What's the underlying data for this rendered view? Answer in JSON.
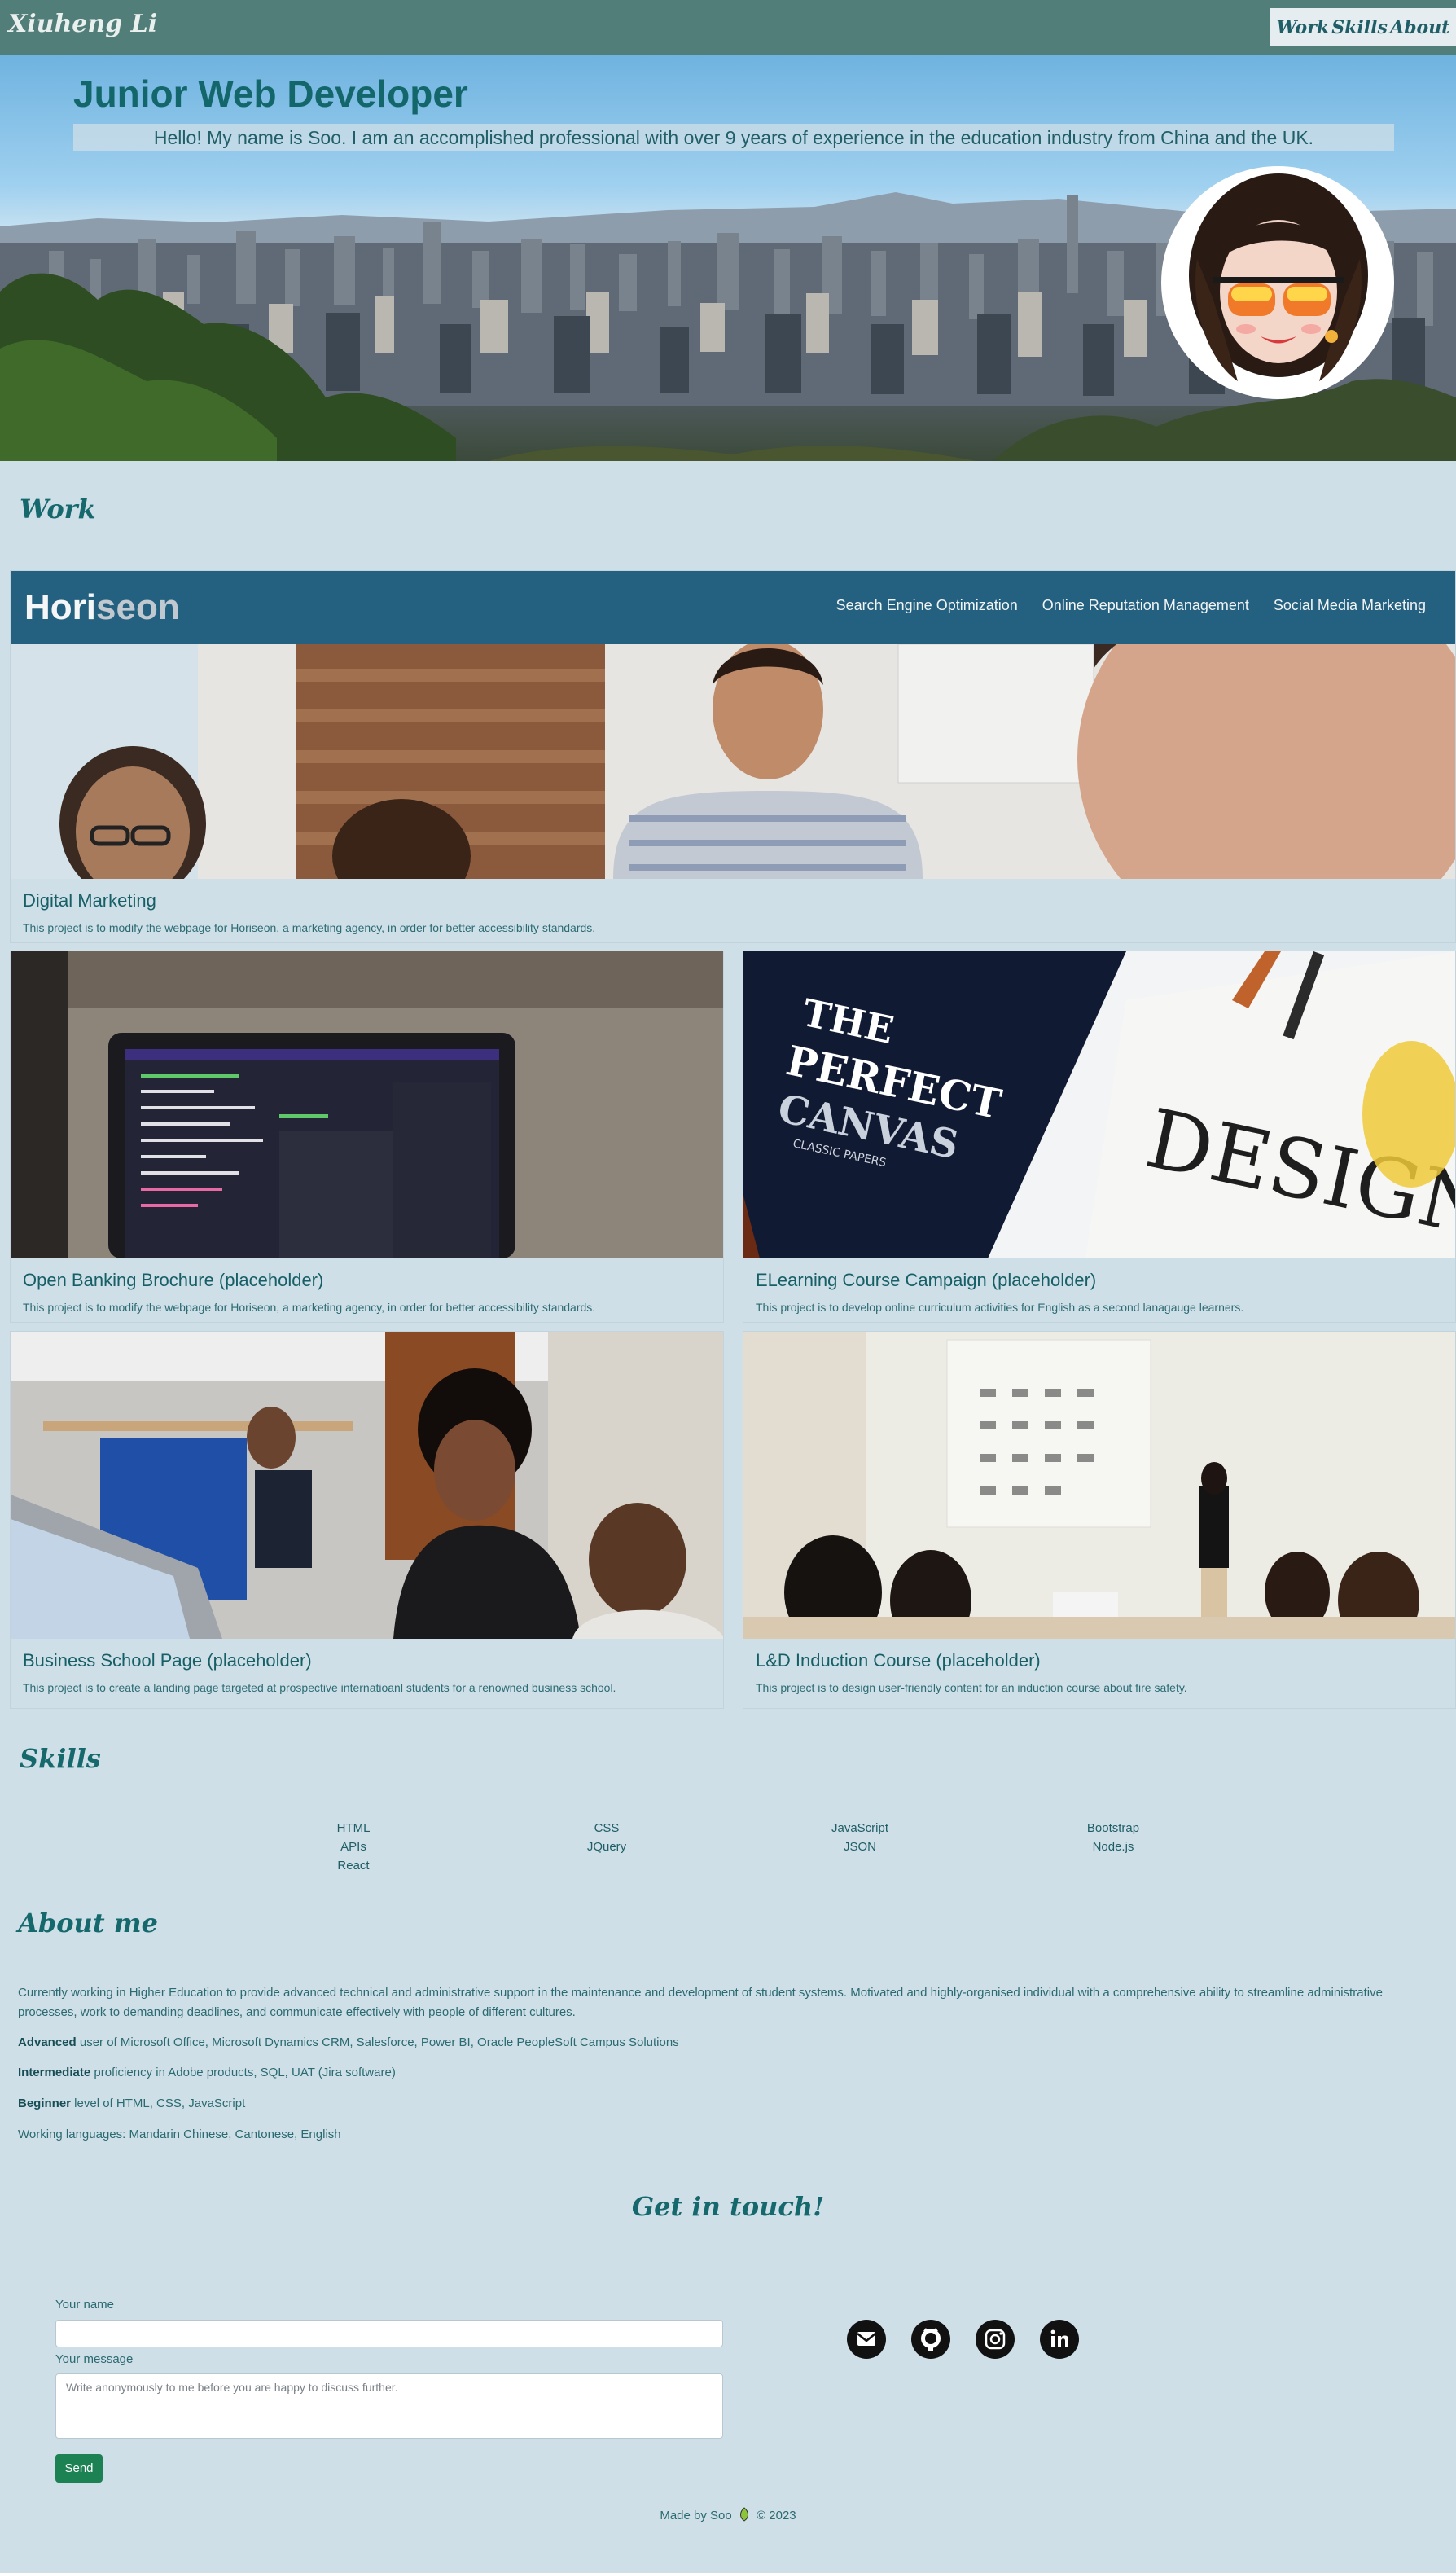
{
  "nav": {
    "brand": "Xiuheng Li",
    "links": [
      "Work",
      "Skills",
      "About"
    ]
  },
  "hero": {
    "title": "Junior Web Developer",
    "subtitle": "Hello! My name is Soo. I am an accomplished professional with over 9 years of experience in the education industry from China and the UK."
  },
  "work": {
    "heading": "Work",
    "featured": {
      "logo_main": "Hori",
      "logo_rest": "seon",
      "links": [
        "Search Engine Optimization",
        "Online Reputation Management",
        "Social Media Marketing"
      ],
      "title": "Digital Marketing",
      "desc": "This project is to modify the webpage for Horiseon, a marketing agency, in order for better accessibility standards."
    },
    "projects": [
      {
        "title": "Open Banking Brochure (placeholder)",
        "desc": "This project is to modify the webpage for Horiseon, a marketing agency, in order for better accessibility standards."
      },
      {
        "title": "ELearning Course Campaign (placeholder)",
        "desc": "This project is to develop online curriculum activities for English as a second lanagauge learners."
      },
      {
        "title": "Business School Page (placeholder)",
        "desc": "This project is to create a landing page targeted at prospective internatioanl students for a renowned business school."
      },
      {
        "title": "L&D Induction Course (placeholder)",
        "desc": "This project is to design user-friendly content for an induction course about fire safety."
      }
    ],
    "book_cover": {
      "line1": "THE",
      "line2": "PERFECT",
      "line3": "CANVAS",
      "sub": "CLASSIC PAPERS",
      "design": "DESIGN"
    }
  },
  "skills": {
    "heading": "Skills",
    "columns": [
      [
        "HTML",
        "APIs",
        "React"
      ],
      [
        "CSS",
        "JQuery"
      ],
      [
        "JavaScript",
        "JSON"
      ],
      [
        "Bootstrap",
        "Node.js"
      ]
    ]
  },
  "about": {
    "heading": "About me",
    "intro": "Currently working in Higher Education to provide advanced technical and administrative support in the maintenance and development of student systems. Motivated and highly-organised individual with a comprehensive ability to streamline administrative processes, work to demanding deadlines, and communicate effectively with people of different cultures.",
    "advanced_label": "Advanced",
    "advanced_text": " user of Microsoft Office, Microsoft Dynamics CRM, Salesforce, Power BI, Oracle PeopleSoft Campus Solutions",
    "intermediate_label": "Intermediate",
    "intermediate_text": " proficiency in Adobe products, SQL, UAT (Jira software)",
    "beginner_label": "Beginner",
    "beginner_text": " level of HTML, CSS, JavaScript",
    "languages": "Working languages: Mandarin Chinese, Cantonese, English"
  },
  "contact": {
    "heading": "Get in touch!",
    "name_label": "Your name",
    "name_value": "",
    "message_label": "Your message",
    "message_placeholder": "Write anonymously to me before you are happy to discuss further.",
    "send_label": "Send",
    "social_icons": [
      "email-icon",
      "github-icon",
      "instagram-icon",
      "linkedin-icon"
    ]
  },
  "footer": {
    "made_by": "Made by Soo",
    "year": "© 2023"
  },
  "colors": {
    "background": "#cfdfe8",
    "nav": "#527e7a",
    "heading": "#15686c",
    "horiseon_bar": "#24607f",
    "send_button": "#1c8153"
  }
}
